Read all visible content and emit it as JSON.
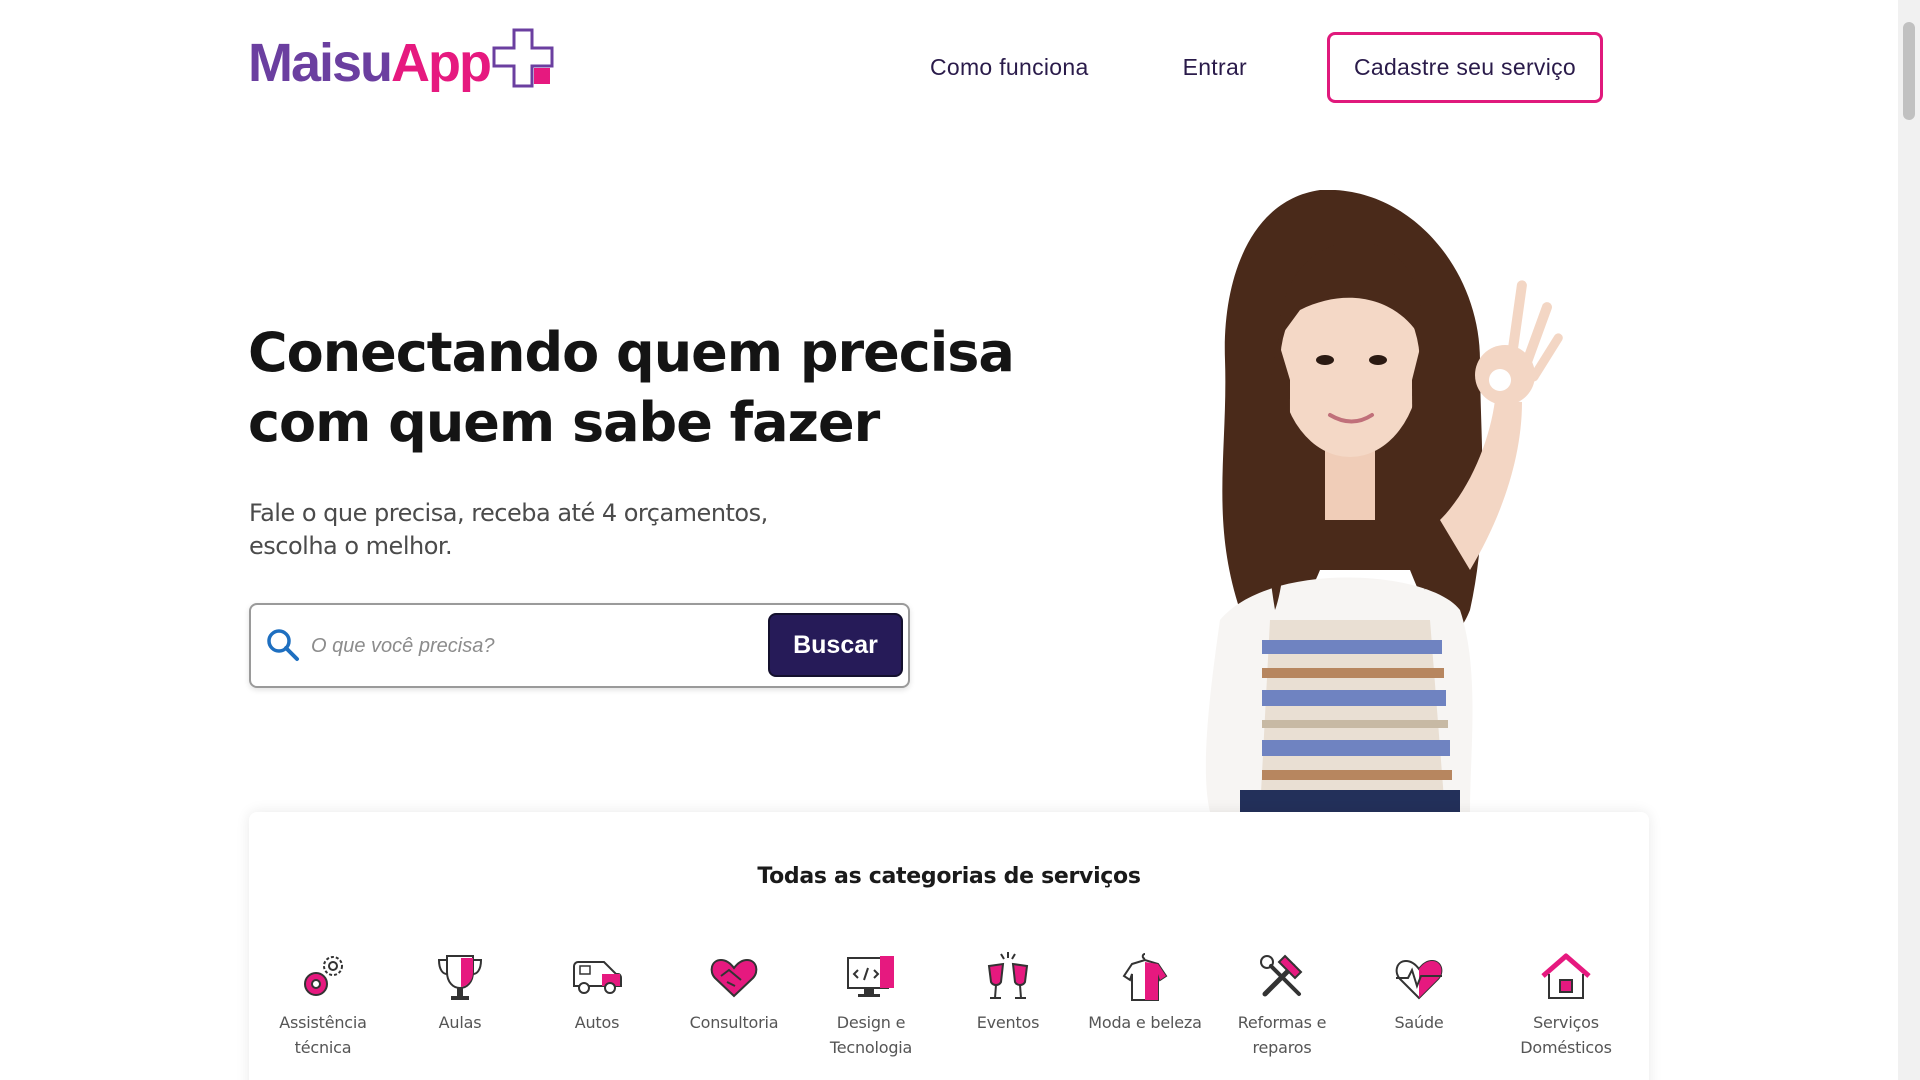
{
  "logo": {
    "part1": "Maisu",
    "part2": "App"
  },
  "nav": {
    "how_it_works": "Como funciona",
    "login": "Entrar",
    "register_service": "Cadastre seu serviço"
  },
  "hero": {
    "title": "Conectando quem precisa com quem sabe fazer",
    "subtitle": "Fale o que precisa, receba até 4 orçamentos, escolha o melhor."
  },
  "search": {
    "placeholder": "O que você precisa?",
    "button": "Buscar"
  },
  "categories": {
    "title": "Todas as categorias de serviços",
    "items": [
      {
        "label": "Assistência técnica",
        "icon": "gears-icon"
      },
      {
        "label": "Aulas",
        "icon": "trophy-icon"
      },
      {
        "label": "Autos",
        "icon": "van-icon"
      },
      {
        "label": "Consultoria",
        "icon": "handshake-icon"
      },
      {
        "label": "Design e Tecnologia",
        "icon": "monitor-code-icon"
      },
      {
        "label": "Eventos",
        "icon": "champagne-glasses-icon"
      },
      {
        "label": "Moda e beleza",
        "icon": "shirt-hanger-icon"
      },
      {
        "label": "Reformas e reparos",
        "icon": "hammer-wrench-icon"
      },
      {
        "label": "Saúde",
        "icon": "heart-pulse-icon"
      },
      {
        "label": "Serviços Domésticos",
        "icon": "house-icon"
      }
    ]
  },
  "colors": {
    "brand_pink": "#e6197f",
    "brand_purple": "#6b3fa0",
    "button_navy": "#261b58",
    "search_blue": "#1e6fc0"
  }
}
